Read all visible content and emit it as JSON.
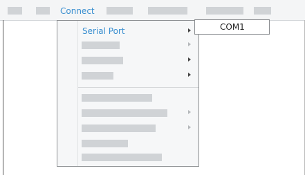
{
  "menubar": {
    "connect_label": "Connect"
  },
  "connect_menu": {
    "items": [
      {
        "label": "Serial Port",
        "has_submenu": true
      }
    ]
  },
  "serial_port_submenu": {
    "items": [
      {
        "label": "COM1"
      }
    ]
  },
  "colors": {
    "accent": "#3a8fd0",
    "menu_bg": "#f6f7f8",
    "placeholder": "#d0d3d6"
  }
}
